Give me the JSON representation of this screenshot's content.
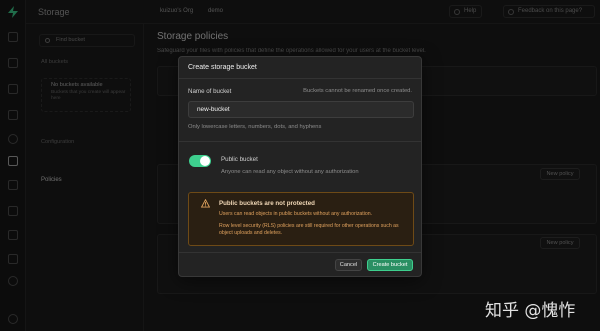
{
  "app": {
    "title": "Storage",
    "org": "kuizuo's Org",
    "project": "demo"
  },
  "topbar": {
    "help": "Help",
    "feedback": "Feedback on this page?"
  },
  "sidebar": {
    "search_placeholder": "Find bucket",
    "section_buckets": "All buckets",
    "empty_title": "No buckets available",
    "empty_text": "Buckets that you create will appear here",
    "section_config": "Configuration",
    "item_policies": "Policies"
  },
  "main": {
    "title": "Storage policies",
    "subtitle": "Safeguard your files with policies that define the operations allowed for your users at the bucket level.",
    "new_policy_1": "New policy",
    "new_policy_2": "New policy"
  },
  "modal": {
    "title": "Create storage bucket",
    "name_label": "Name of bucket",
    "name_note": "Buckets cannot be renamed once created.",
    "name_value": "new-bucket",
    "name_hint": "Only lowercase letters, numbers, dots, and hyphens",
    "public_label": "Public bucket",
    "public_hint": "Anyone can read any object without any authorization",
    "public_enabled": true,
    "warning_title": "Public buckets are not protected",
    "warning_line1": "Users can read objects in public buckets without any authorization.",
    "warning_line2": "Row level security (RLS) policies are still required for other operations such as object uploads and deletes.",
    "cancel": "Cancel",
    "create": "Create bucket"
  },
  "watermark": "知乎 @愧怍",
  "colors": {
    "accent": "#3ecf8e",
    "warning_border": "#6e4a16",
    "warning_text": "#e0a25e"
  }
}
